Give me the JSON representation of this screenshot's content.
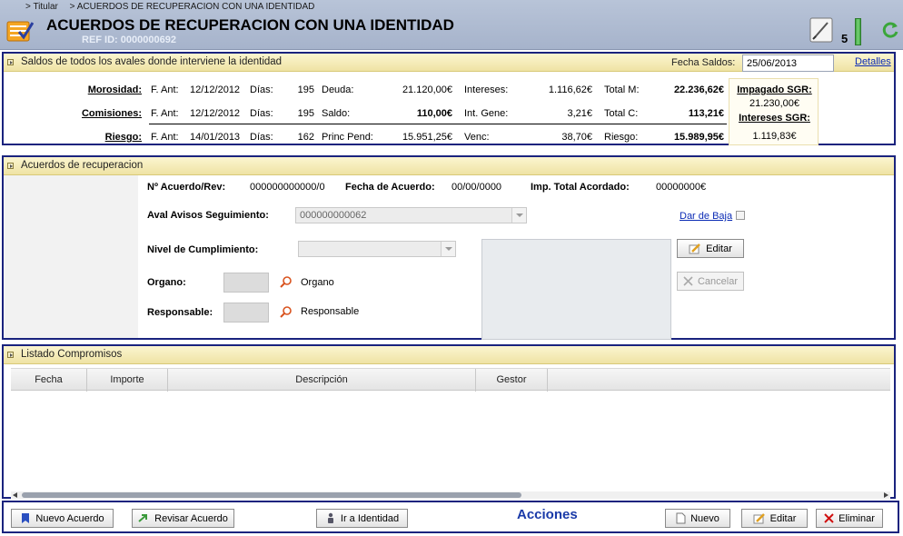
{
  "breadcrumb": [
    "> Titular",
    "> ACUERDOS DE RECUPERACION CON UNA IDENTIDAD"
  ],
  "header": {
    "title": "ACUERDOS DE RECUPERACION CON UNA IDENTIDAD",
    "ref_id": "REF ID: 0000000692",
    "count": "5",
    "icons": [
      "checklist-app-icon",
      "note-icon",
      "level-bar",
      "refresh-icon"
    ]
  },
  "saldos": {
    "title": "Saldos de todos los avales donde interviene la identidad",
    "fecha_label": "Fecha Saldos:",
    "fecha_value": "25/06/2013",
    "detalles": "Detalles",
    "rows": [
      {
        "label": "Morosidad:",
        "fant_label": "F. Ant:",
        "fant": "12/12/2012",
        "dias_label": "Días:",
        "dias": "195",
        "c1_label": "Deuda:",
        "c1": "21.120,00€",
        "c2_label": "Intereses:",
        "c2": "1.116,62€",
        "c3_label": "Total M:",
        "c3": "22.236,62€"
      },
      {
        "label": "Comisiones:",
        "fant_label": "F. Ant:",
        "fant": "12/12/2012",
        "dias_label": "Días:",
        "dias": "195",
        "c1_label": "Saldo:",
        "c1": "110,00€",
        "c2_label": "Int. Gene:",
        "c2": "3,21€",
        "c3_label": "Total C:",
        "c3": "113,21€"
      },
      {
        "label": "Riesgo:",
        "fant_label": "F. Ant:",
        "fant": "14/01/2013",
        "dias_label": "Días:",
        "dias": "162",
        "c1_label": "Princ Pend:",
        "c1": "15.951,25€",
        "c2_label": "Venc:",
        "c2": "38,70€",
        "c3_label": "Riesgo:",
        "c3": "15.989,95€"
      }
    ],
    "sgr": {
      "impagado_label": "Impagado SGR:",
      "impagado_value": "21.230,00€",
      "intereses_label": "Intereses SGR:",
      "intereses_value": "1.119,83€"
    }
  },
  "acuerdos": {
    "title": "Acuerdos de recuperacion",
    "num_label": "Nº Acuerdo/Rev:",
    "num_value": "000000000000/0",
    "fecha_label": "Fecha de Acuerdo:",
    "fecha_value": "00/00/0000",
    "imp_label": "Imp. Total Acordado:",
    "imp_value": "00000000€",
    "aval_label": "Aval Avisos Seguimiento:",
    "aval_value": "000000000062",
    "dar_baja": "Dar de Baja",
    "nivel_label": "Nivel de Cumplimiento:",
    "nivel_value": "",
    "organo_label": "Organo:",
    "organo_lookup": "Organo",
    "responsable_label": "Responsable:",
    "responsable_lookup": "Responsable",
    "editar": "Editar",
    "cancelar": "Cancelar"
  },
  "compromisos": {
    "title": "Listado Compromisos",
    "columns": [
      "Fecha",
      "Importe",
      "Descripción",
      "Gestor"
    ]
  },
  "acciones": {
    "title": "Acciones",
    "nuevo_acuerdo": "Nuevo Acuerdo",
    "revisar_acuerdo": "Revisar Acuerdo",
    "ir_identidad": "Ir a Identidad",
    "nuevo": "Nuevo",
    "editar": "Editar",
    "eliminar": "Eliminar"
  }
}
